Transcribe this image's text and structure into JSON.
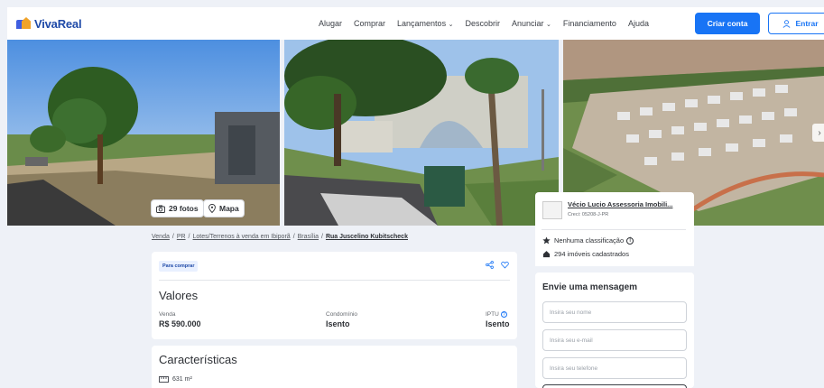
{
  "header": {
    "logo_text": "VivaReal",
    "nav": [
      {
        "label": "Alugar"
      },
      {
        "label": "Comprar"
      },
      {
        "label": "Lançamentos",
        "has_dropdown": true
      },
      {
        "label": "Descobrir"
      },
      {
        "label": "Anunciar",
        "has_dropdown": true
      },
      {
        "label": "Financiamento"
      },
      {
        "label": "Ajuda"
      }
    ],
    "create_account": "Criar conta",
    "login": "Entrar"
  },
  "gallery": {
    "photos_label": "29 fotos",
    "map_label": "Mapa"
  },
  "breadcrumb": {
    "items": [
      "Venda",
      "PR",
      "Lotes/Terrenos à venda em Ibiporã",
      "Brasília"
    ],
    "current": "Rua Juscelino Kubitscheck"
  },
  "listing": {
    "tag": "Para comprar",
    "values_title": "Valores",
    "sale_label": "Venda",
    "sale_value": "R$ 590.000",
    "condo_label": "Condomínio",
    "condo_value": "Isento",
    "iptu_label": "IPTU",
    "iptu_value": "Isento",
    "features_title": "Características",
    "area": "631 m²"
  },
  "agent": {
    "name": "Vécio Lucio Assessoria Imobili...",
    "creci": "Creci: 05208-J-PR",
    "rating": "Nenhuma classificação",
    "properties": "294 imóveis cadastrados"
  },
  "contact": {
    "title": "Envie uma mensagem",
    "name_placeholder": "Insira seu nome",
    "email_placeholder": "Insira seu e-mail",
    "phone_placeholder": "Insira seu telefone"
  },
  "colors": {
    "primary": "#1874f5",
    "brand": "#1f4aa8",
    "accent": "#f0a32a",
    "background": "#eef1f7"
  }
}
